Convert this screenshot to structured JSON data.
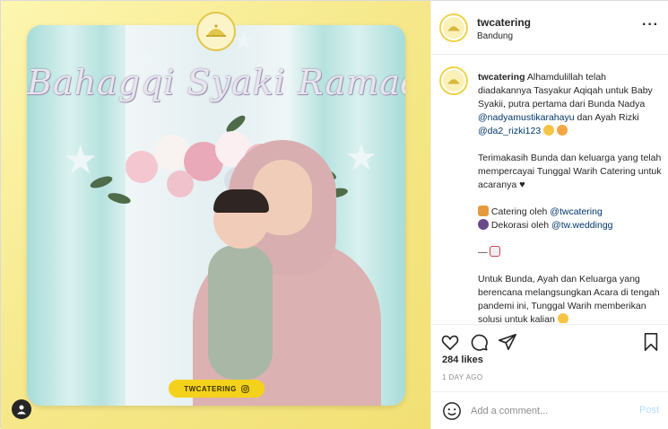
{
  "media": {
    "banner_text": "Bahagqi Syaki Ramadhan",
    "badge_text": "TWCATERING",
    "handle_pill": "TWCATERING",
    "colors": {
      "frame_bg": "#f6e98c",
      "pill": "#f4d21c"
    }
  },
  "header": {
    "username": "twcatering",
    "location": "Bandung",
    "more_icon": "ellipsis-icon"
  },
  "caption": {
    "username": "twcatering",
    "p1_a": "Alhamdulillah telah diadakannya Tasyakur Aqiqah untuk Baby Syakii, putra pertama dari Bunda Nadya ",
    "mention1": "@nadyamustikarahayu",
    "p1_b": " dan Ayah Rizki ",
    "mention2": "@da2_rizki123",
    "p2": "Terimakasih Bunda dan keluarga yang telah mempercayai Tunggal Warih Catering untuk acaranya",
    "l3_a": "Catering oleh ",
    "mention3": "@twcatering",
    "l4_a": "Dekorasi oleh ",
    "mention4": "@tw.weddingg",
    "dash": "—",
    "p5": "Untuk Bunda, Ayah dan Keluarga yang berencana melangsungkan Acara di tengah pandemi ini, Tunggal Warih memberikan solusi untuk kalian"
  },
  "actions": {
    "icons": [
      "heart-icon",
      "comment-icon",
      "share-icon",
      "bookmark-icon"
    ]
  },
  "likes": "284 likes",
  "timestamp": "1 DAY AGO",
  "comment_box": {
    "placeholder": "Add a comment...",
    "post_label": "Post"
  }
}
